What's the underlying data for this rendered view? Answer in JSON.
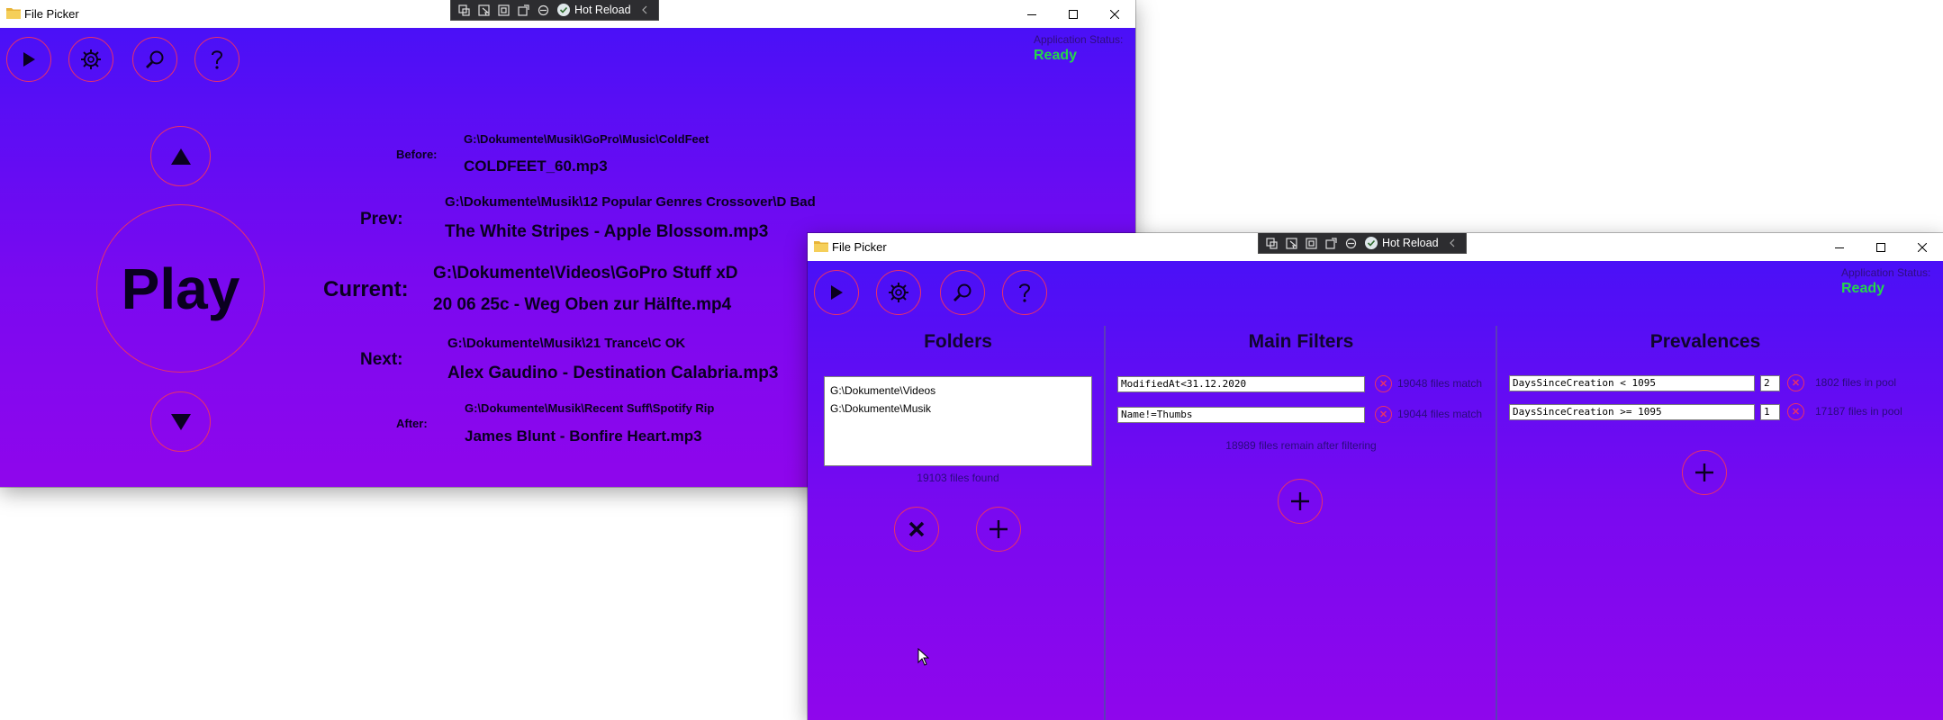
{
  "window1": {
    "title": "File Picker",
    "hot_reload": "Hot Reload",
    "status_label": "Application Status:",
    "status_value": "Ready",
    "play_label": "Play",
    "tracks": [
      {
        "label": "Before:",
        "path": "G:\\Dokumente\\Musik\\GoPro\\Music\\ColdFeet",
        "file": "COLDFEET_60.mp3"
      },
      {
        "label": "Prev:",
        "path": "G:\\Dokumente\\Musik\\12 Popular Genres Crossover\\D Bad",
        "file": "The White Stripes - Apple Blossom.mp3"
      },
      {
        "label": "Current:",
        "path": "G:\\Dokumente\\Videos\\GoPro Stuff xD",
        "file": "20 06 25c - Weg Oben zur Hälfte.mp4"
      },
      {
        "label": "Next:",
        "path": "G:\\Dokumente\\Musik\\21 Trance\\C OK",
        "file": "Alex Gaudino - Destination Calabria.mp3"
      },
      {
        "label": "After:",
        "path": "G:\\Dokumente\\Musik\\Recent Suff\\Spotify Rip",
        "file": "James Blunt - Bonfire Heart.mp3"
      }
    ]
  },
  "window2": {
    "title": "File Picker",
    "hot_reload": "Hot Reload",
    "status_label": "Application Status:",
    "status_value": "Ready",
    "folders": {
      "title": "Folders",
      "items": [
        "G:\\Dokumente\\Videos",
        "G:\\Dokumente\\Musik"
      ],
      "found": "19103 files found"
    },
    "main_filters": {
      "title": "Main Filters",
      "filters": [
        {
          "expr": "ModifiedAt<31.12.2020",
          "match": "19048 files match"
        },
        {
          "expr": "Name!=Thumbs",
          "match": "19044 files match"
        }
      ],
      "remain": "18989 files remain after filtering"
    },
    "prevalences": {
      "title": "Prevalences",
      "rules": [
        {
          "expr": "DaysSinceCreation < 1095",
          "weight": "2",
          "pool": "1802 files in pool"
        },
        {
          "expr": "DaysSinceCreation >= 1095",
          "weight": "1",
          "pool": "17187 files in pool"
        }
      ]
    }
  },
  "colors": {
    "accent_ring": "#e8306a",
    "status_ready": "#25d64b",
    "gradient_top": "#4a10f7",
    "gradient_bottom": "#8f06ec"
  },
  "icons": [
    "folder-icon",
    "play-icon",
    "gear-icon",
    "search-icon",
    "help-icon",
    "arrow-up-icon",
    "arrow-down-icon",
    "close-icon",
    "plus-icon",
    "minimize-icon",
    "maximize-icon",
    "cursor-icon"
  ]
}
